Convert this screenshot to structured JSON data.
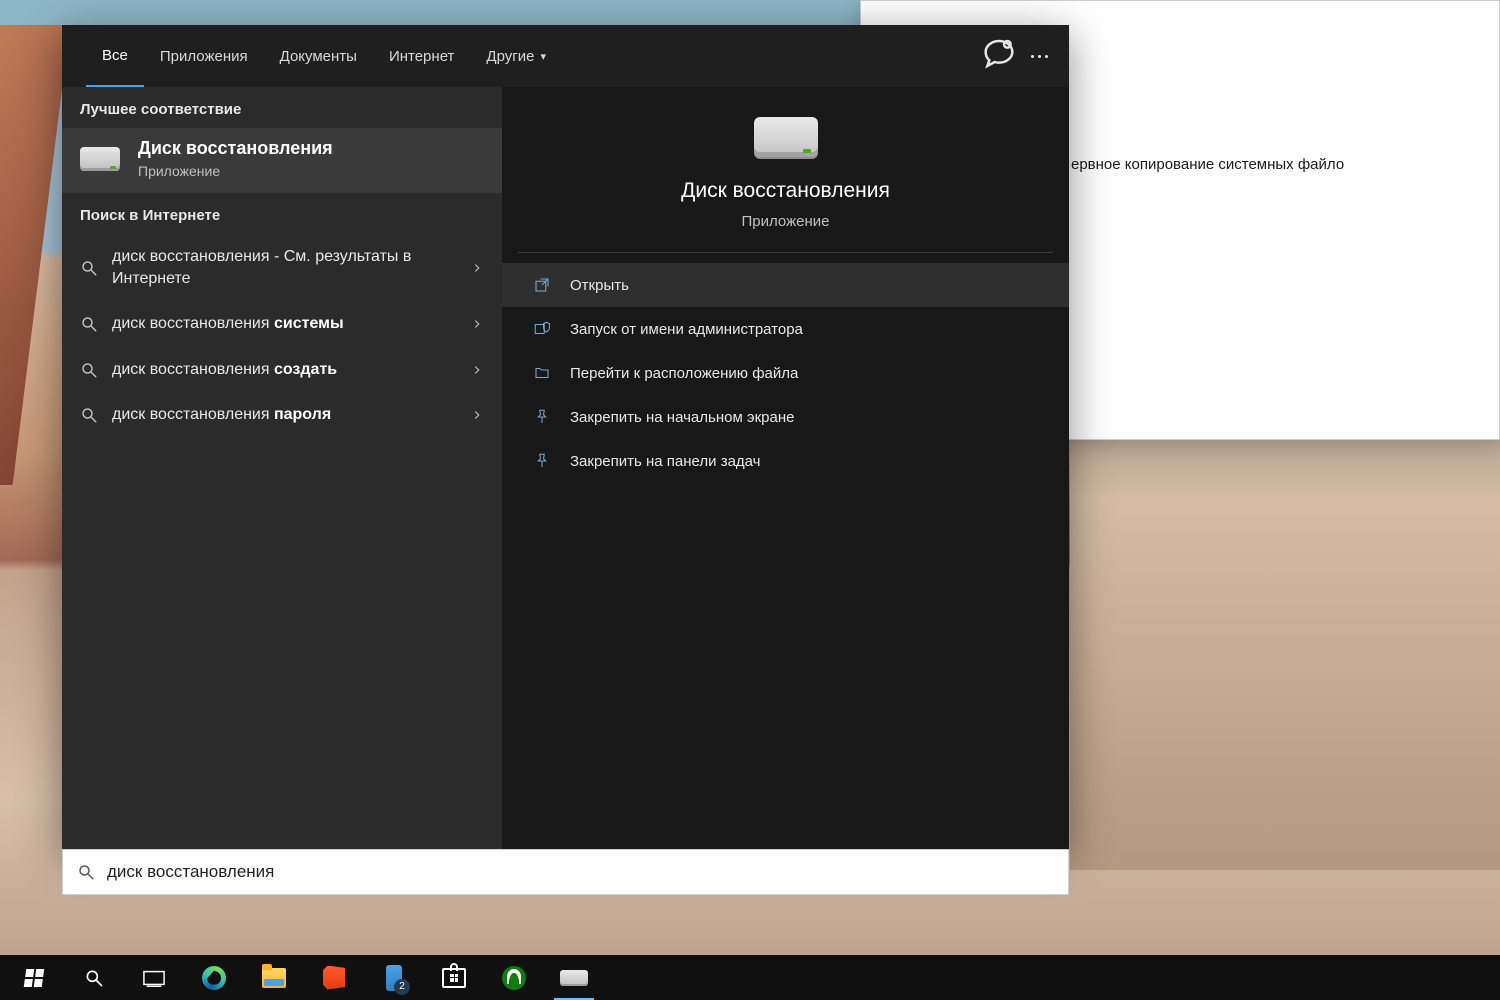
{
  "behind_window": {
    "visible_text": "ервное копирование системных файло"
  },
  "tabs": {
    "items": [
      {
        "label": "Все"
      },
      {
        "label": "Приложения"
      },
      {
        "label": "Документы"
      },
      {
        "label": "Интернет"
      },
      {
        "label": "Другие"
      }
    ]
  },
  "left": {
    "best_match_label": "Лучшее соответствие",
    "best": {
      "title": "Диск восстановления",
      "subtitle": "Приложение"
    },
    "web_label": "Поиск в Интернете",
    "web_items": [
      {
        "prefix": "диск восстановления",
        "bold": "",
        "suffix": " - См. результаты в Интернете"
      },
      {
        "prefix": "диск восстановления ",
        "bold": "системы",
        "suffix": ""
      },
      {
        "prefix": "диск восстановления ",
        "bold": "создать",
        "suffix": ""
      },
      {
        "prefix": "диск восстановления ",
        "bold": "пароля",
        "suffix": ""
      }
    ]
  },
  "right": {
    "title": "Диск восстановления",
    "subtitle": "Приложение",
    "actions": [
      {
        "icon": "open",
        "label": "Открыть",
        "selected": true
      },
      {
        "icon": "admin",
        "label": "Запуск от имени администратора",
        "selected": false
      },
      {
        "icon": "location",
        "label": "Перейти к расположению файла",
        "selected": false
      },
      {
        "icon": "pin-start",
        "label": "Закрепить на начальном экране",
        "selected": false
      },
      {
        "icon": "pin-taskbar",
        "label": "Закрепить на панели задач",
        "selected": false
      }
    ]
  },
  "search": {
    "value": "диск восстановления"
  },
  "taskbar": {
    "phone_badge": "2"
  }
}
